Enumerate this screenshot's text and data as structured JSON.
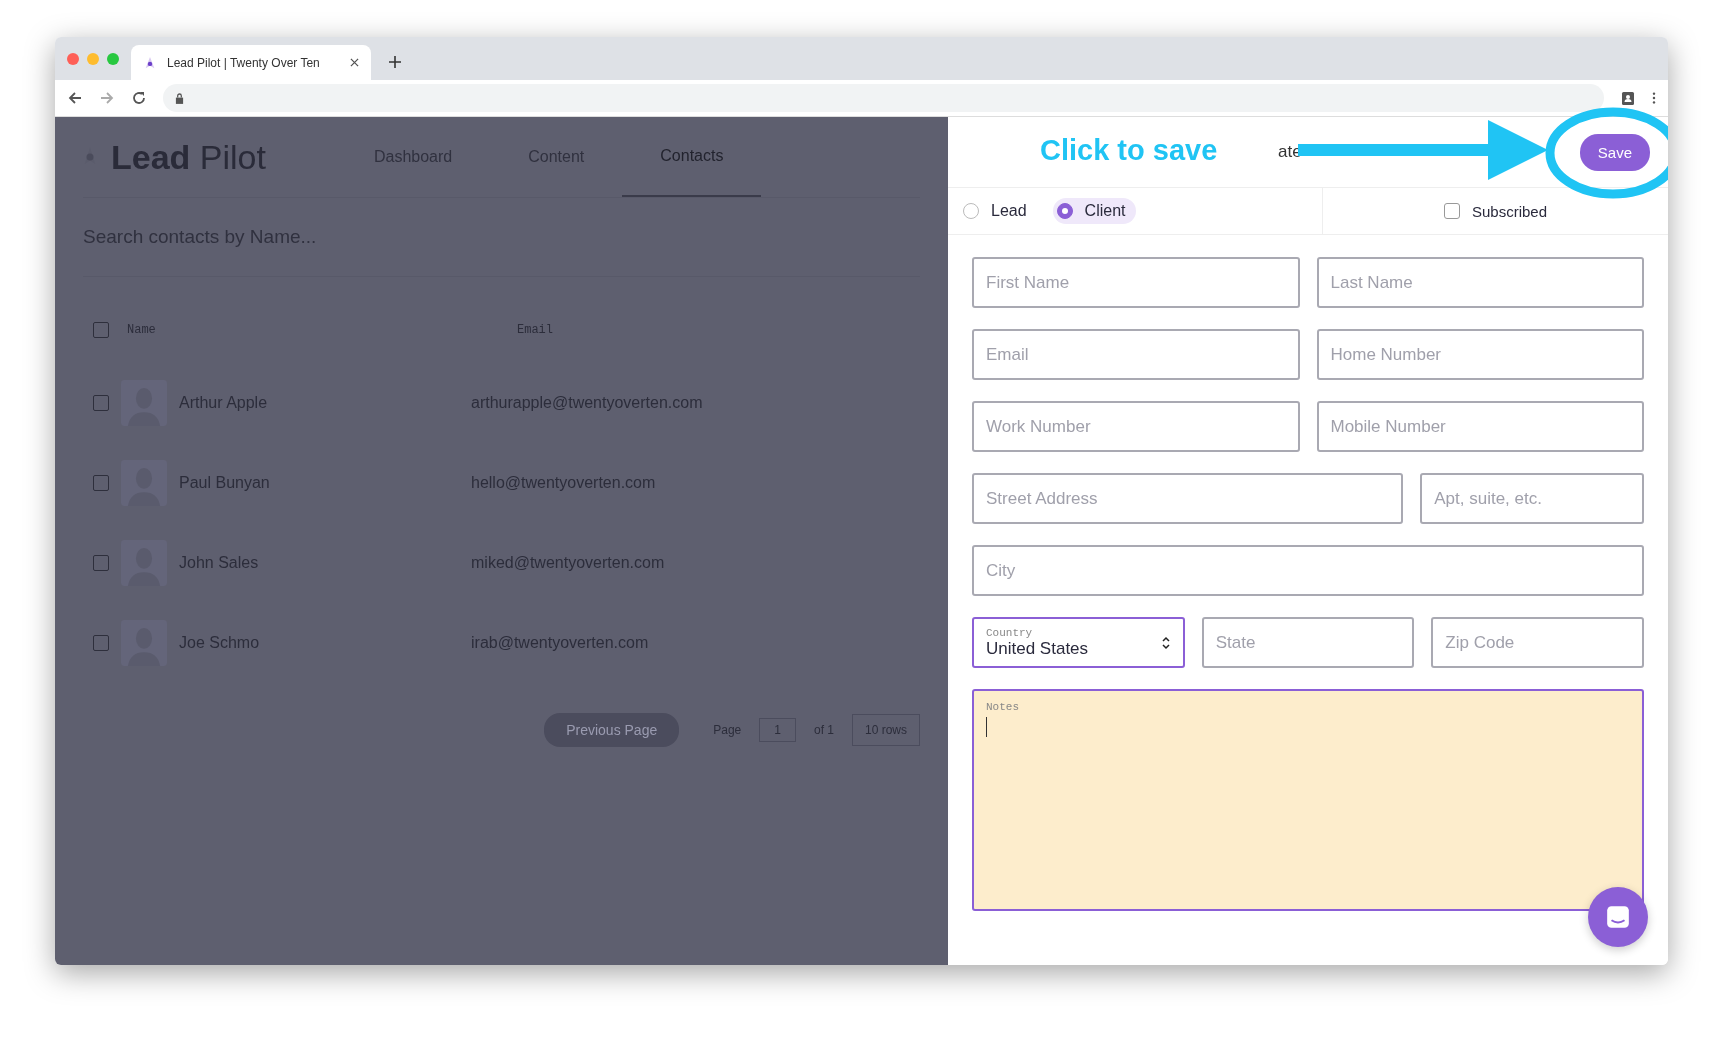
{
  "browser": {
    "tab_title": "Lead Pilot | Twenty Over Ten"
  },
  "app": {
    "logo": {
      "bold": "Lead",
      "light": "Pilot"
    },
    "nav": [
      {
        "label": "Dashboard",
        "selected": false
      },
      {
        "label": "Content",
        "selected": false
      },
      {
        "label": "Contacts",
        "selected": true
      }
    ],
    "search": {
      "placeholder": "Search contacts by Name..."
    },
    "table": {
      "columns": [
        "Name",
        "Email"
      ],
      "all_checked": false,
      "rows": [
        {
          "name": "Arthur Apple",
          "email": "arthurapple@twentyoverten.com",
          "checked": false
        },
        {
          "name": "Paul Bunyan",
          "email": "hello@twentyoverten.com",
          "checked": false
        },
        {
          "name": "John Sales",
          "email": "miked@twentyoverten.com",
          "checked": false
        },
        {
          "name": "Joe Schmo",
          "email": "irab@twentyoverten.com",
          "checked": false
        }
      ]
    },
    "pagination": {
      "previous": "Previous Page",
      "page_label": "Page",
      "page": "1",
      "of": "of 1",
      "rows": "10 rows"
    }
  },
  "panel": {
    "title": "ate",
    "save": "Save",
    "types": [
      {
        "label": "Lead",
        "selected": false
      },
      {
        "label": "Client",
        "selected": true
      }
    ],
    "subscribed": {
      "label": "Subscribed",
      "checked": false
    },
    "rows": [
      [
        {
          "kind": "text",
          "placeholder": "First Name"
        },
        {
          "kind": "text",
          "placeholder": "Last Name"
        }
      ],
      [
        {
          "kind": "text",
          "placeholder": "Email"
        },
        {
          "kind": "text",
          "placeholder": "Home Number"
        }
      ],
      [
        {
          "kind": "text",
          "placeholder": "Work Number"
        },
        {
          "kind": "text",
          "placeholder": "Mobile Number"
        }
      ],
      [
        {
          "kind": "text",
          "placeholder": "Street Address",
          "wide": true
        },
        {
          "kind": "text",
          "placeholder": "Apt, suite, etc."
        }
      ],
      [
        {
          "kind": "text",
          "placeholder": "City"
        }
      ],
      [
        {
          "kind": "select",
          "label": "Country",
          "value": "United States"
        },
        {
          "kind": "text",
          "placeholder": "State"
        },
        {
          "kind": "text",
          "placeholder": "Zip Code"
        }
      ]
    ],
    "notes": {
      "label": "Notes"
    }
  },
  "annotation": {
    "text": "Click to save"
  }
}
